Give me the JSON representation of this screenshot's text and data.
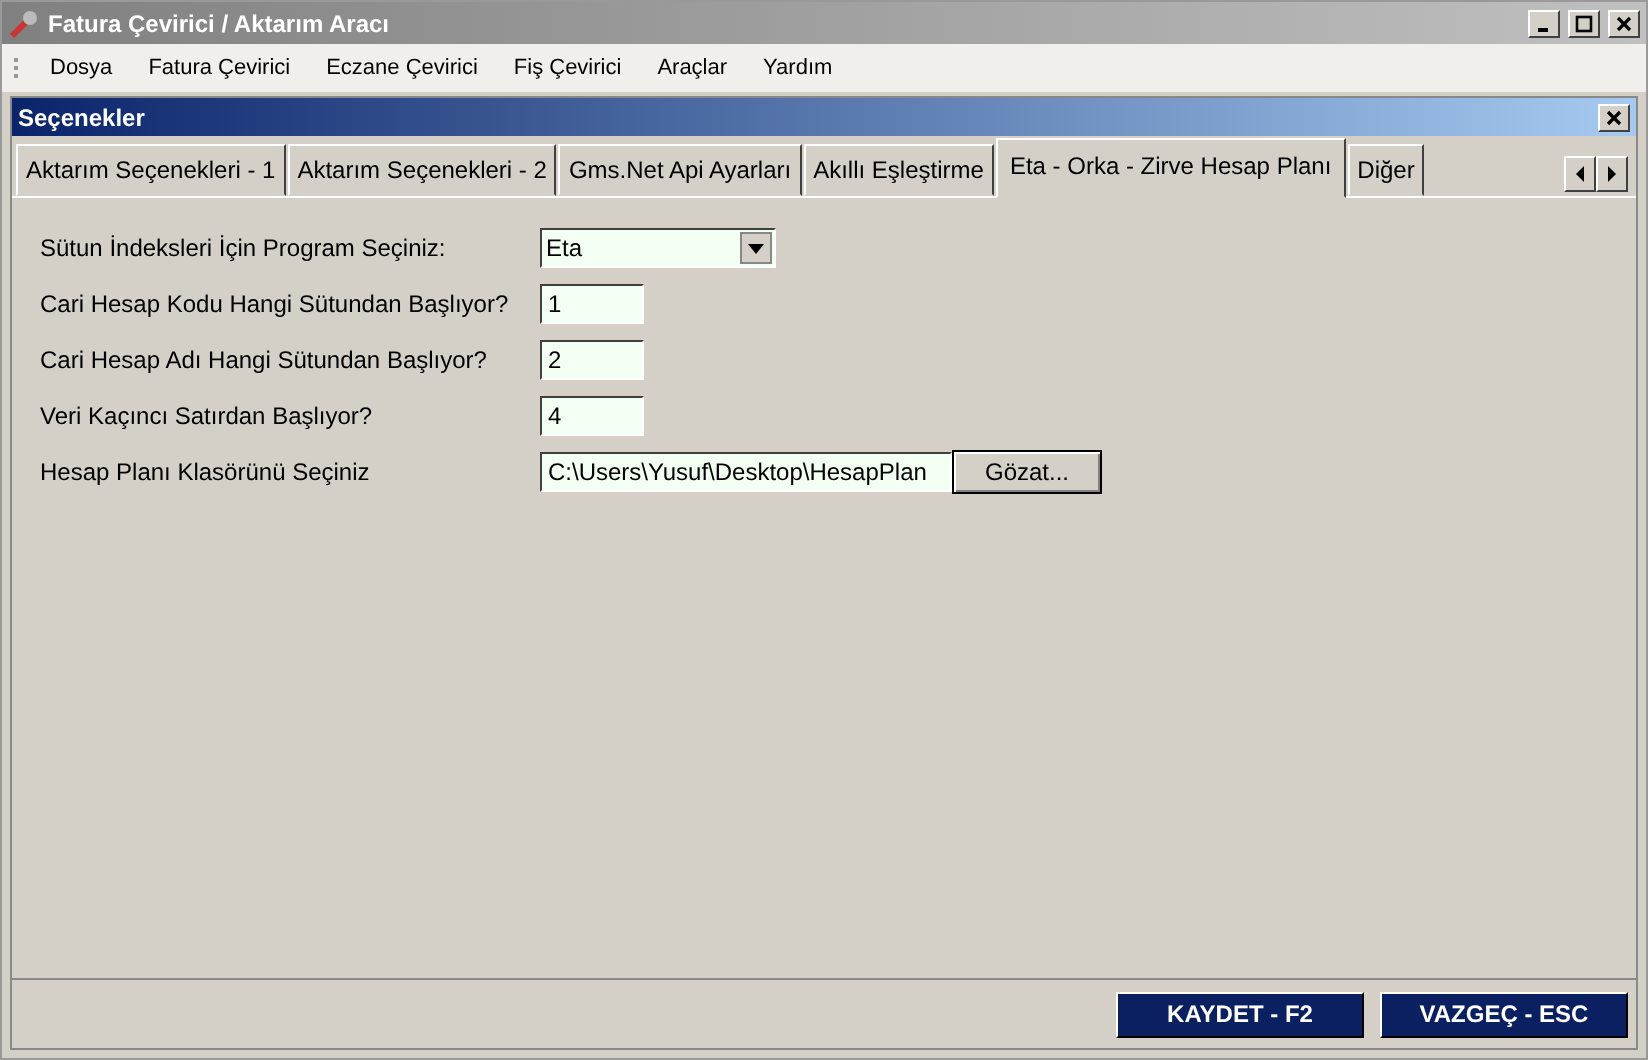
{
  "window": {
    "title": "Fatura Çevirici / Aktarım Aracı"
  },
  "menu": [
    "Dosya",
    "Fatura Çevirici",
    "Eczane Çevirici",
    "Fiş Çevirici",
    "Araçlar",
    "Yardım"
  ],
  "panel": {
    "title": "Seçenekler"
  },
  "tabs": [
    {
      "label": "Aktarım Seçenekleri - 1",
      "selected": false
    },
    {
      "label": "Aktarım Seçenekleri - 2",
      "selected": false
    },
    {
      "label": "Gms.Net Api Ayarları",
      "selected": false
    },
    {
      "label": "Akıllı Eşleştirme",
      "selected": false
    },
    {
      "label": "Eta - Orka - Zirve Hesap Planı",
      "selected": true
    },
    {
      "label": "Diğer",
      "selected": false
    }
  ],
  "fields": [
    {
      "kind": "dropdown",
      "label": "Sütun İndeksleri İçin Program Seçiniz:",
      "value": "Eta"
    },
    {
      "kind": "text",
      "label": "Cari Hesap Kodu Hangi Sütundan Başlıyor?",
      "value": "1"
    },
    {
      "kind": "text",
      "label": "Cari Hesap Adı Hangi Sütundan Başlıyor?",
      "value": "2"
    },
    {
      "kind": "text",
      "label": "Veri Kaçıncı Satırdan Başlıyor?",
      "value": "4"
    },
    {
      "kind": "path",
      "label": "Hesap Planı Klasörünü Seçiniz",
      "value": "C:\\Users\\Yusuf\\Desktop\\HesapPlan",
      "button": "Gözat..."
    }
  ],
  "buttons": [
    "KAYDET - F2",
    "VAZGEÇ - ESC"
  ]
}
